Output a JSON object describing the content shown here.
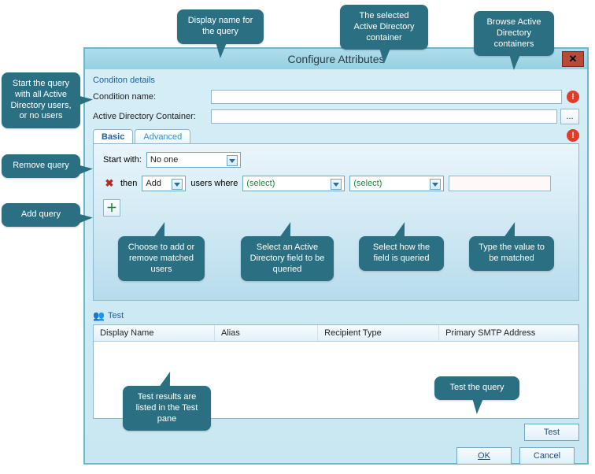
{
  "window": {
    "title": "Configure Attributes"
  },
  "section": {
    "condition_details": "Conditon details",
    "condition_name_label": "Condition name:",
    "adc_label": "Active Directory Container:",
    "browse_glyph": "..."
  },
  "tabs": {
    "basic": "Basic",
    "advanced": "Advanced"
  },
  "flow": {
    "start_label": "Start with:",
    "start_value": "No one",
    "then_label": "then",
    "action_value": "Add",
    "users_where": "users where",
    "field_value": "(select)",
    "op_value": "(select)",
    "value_input": ""
  },
  "test": {
    "label": "Test",
    "columns": {
      "display_name": "Display Name",
      "alias": "Alias",
      "recipient_type": "Recipient Type",
      "smtp": "Primary SMTP Address"
    },
    "test_button": "Test"
  },
  "footer": {
    "ok": "OK",
    "cancel": "Cancel"
  },
  "callouts": {
    "display_name": "Display name for the query",
    "selected_adc": "The selected Active Directory container",
    "browse_adc": "Browse Active Directory containers",
    "start_query": "Start the query with all Active Directory users, or no users",
    "remove_query": "Remove query",
    "add_query": "Add query",
    "choose_add_remove": "Choose to add or remove matched users",
    "select_field": "Select an Active Directory field to be queried",
    "select_how": "Select how the field is queried",
    "type_value": "Type the value to be matched",
    "test_results": "Test results are listed in the Test pane",
    "test_query": "Test the query"
  }
}
